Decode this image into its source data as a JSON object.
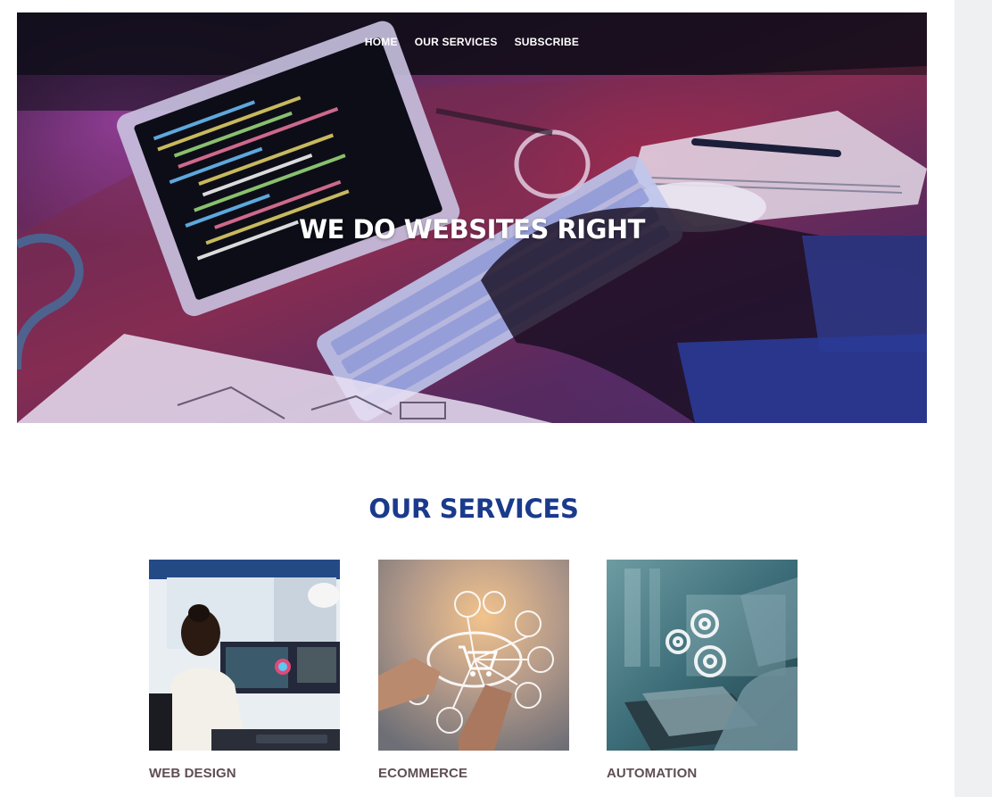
{
  "nav": {
    "items": [
      {
        "label": "HOME"
      },
      {
        "label": "OUR SERVICES"
      },
      {
        "label": "SUBSCRIBE"
      }
    ]
  },
  "hero": {
    "title": "WE DO WEBSITES RIGHT"
  },
  "services": {
    "title": "OUR SERVICES",
    "cards": [
      {
        "label": "WEB DESIGN",
        "image_icon": "developer-at-monitors-photo"
      },
      {
        "label": "ECOMMERCE",
        "image_icon": "shopping-cart-hologram-photo"
      },
      {
        "label": "AUTOMATION",
        "image_icon": "gears-laptop-photo"
      }
    ]
  },
  "colors": {
    "services_title": "#1a3a8c",
    "card_label": "#5f4e55",
    "side_panel": "#eef0f2"
  }
}
